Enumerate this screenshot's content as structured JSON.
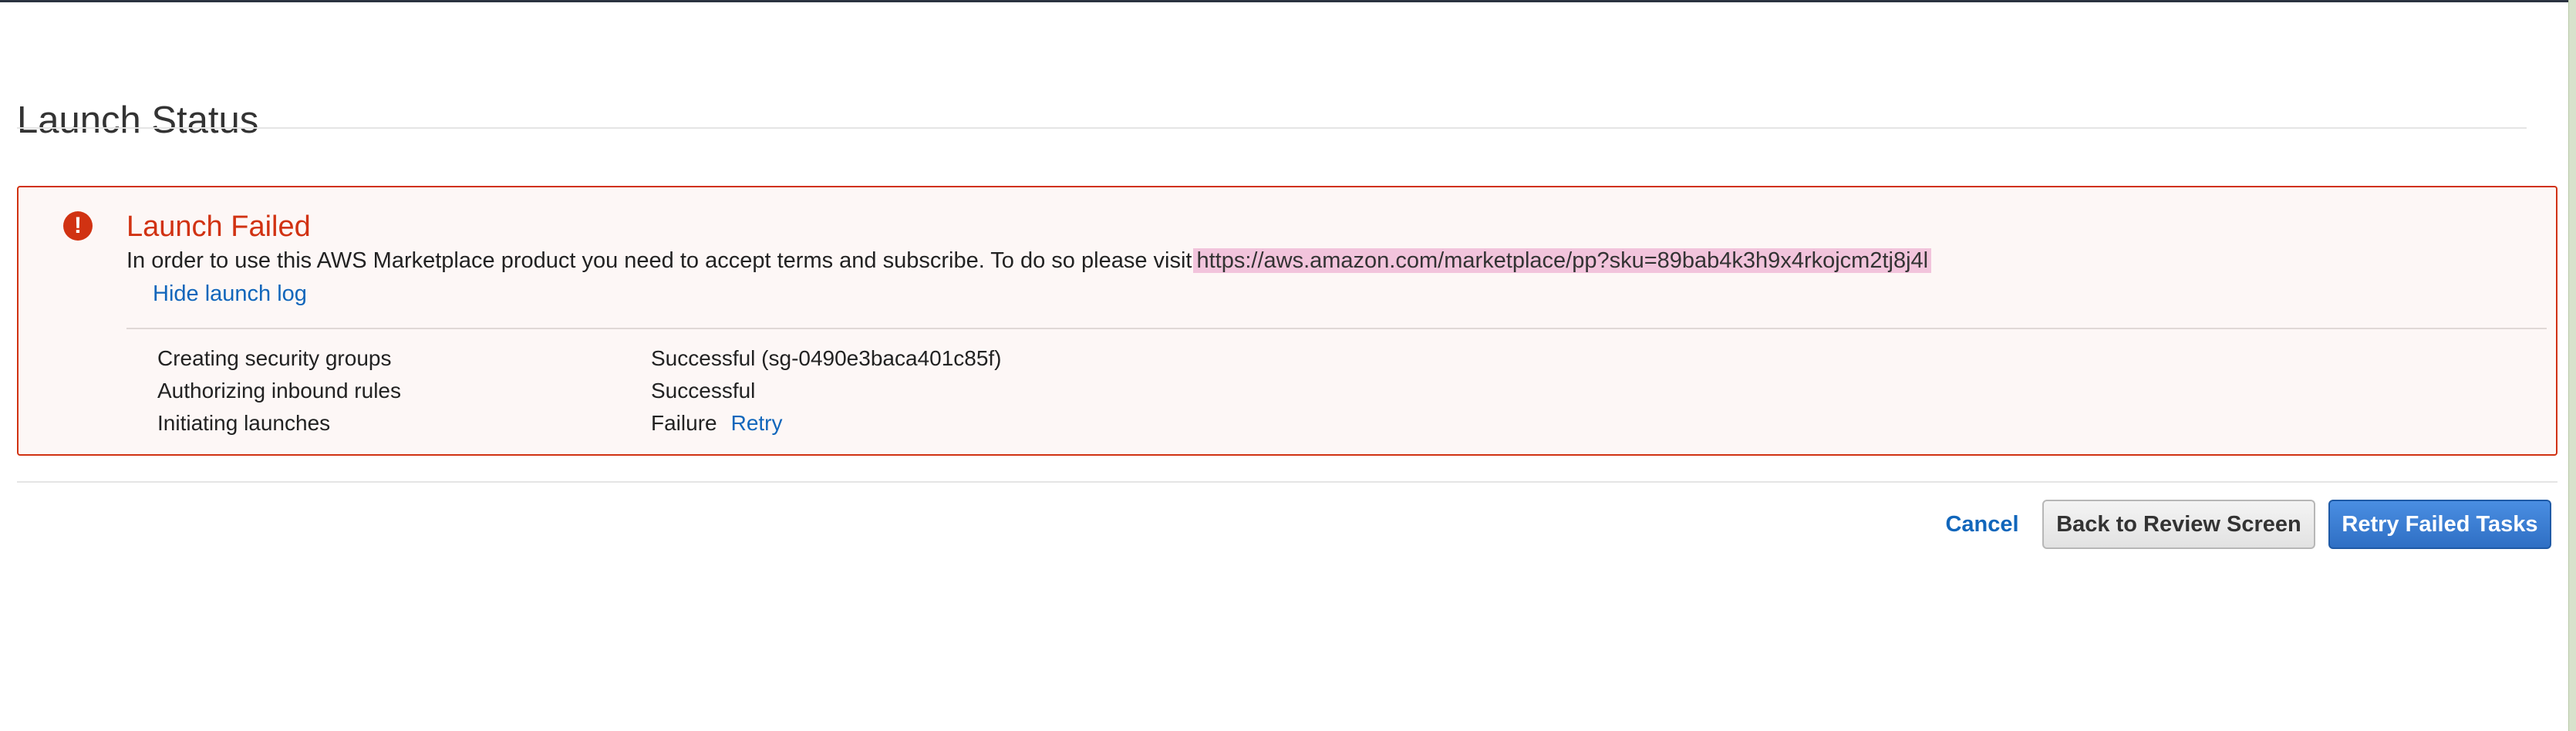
{
  "page": {
    "title": "Launch Status"
  },
  "alert": {
    "title": "Launch Failed",
    "message": "In order to use this AWS Marketplace product you need to accept terms and subscribe. To do so please visit",
    "link_text": "https://aws.amazon.com/marketplace/pp?sku=89bab4k3h9x4rkojcm2tj8j4l",
    "toggle_label": "Hide launch log"
  },
  "log": {
    "rows": [
      {
        "label": "Creating security groups",
        "status": "Successful (sg-0490e3baca401c85f)"
      },
      {
        "label": "Authorizing inbound rules",
        "status": "Successful"
      },
      {
        "label": "Initiating launches",
        "status": "Failure",
        "action": "Retry"
      }
    ]
  },
  "actions": {
    "cancel": "Cancel",
    "back": "Back to Review Screen",
    "retry": "Retry Failed Tasks"
  },
  "colors": {
    "error": "#d13212",
    "link": "#1166bb",
    "primary_button": "#2f6fc4",
    "highlight": "#f2c4dc"
  },
  "icons": {
    "alert": "exclamation-circle-icon"
  }
}
